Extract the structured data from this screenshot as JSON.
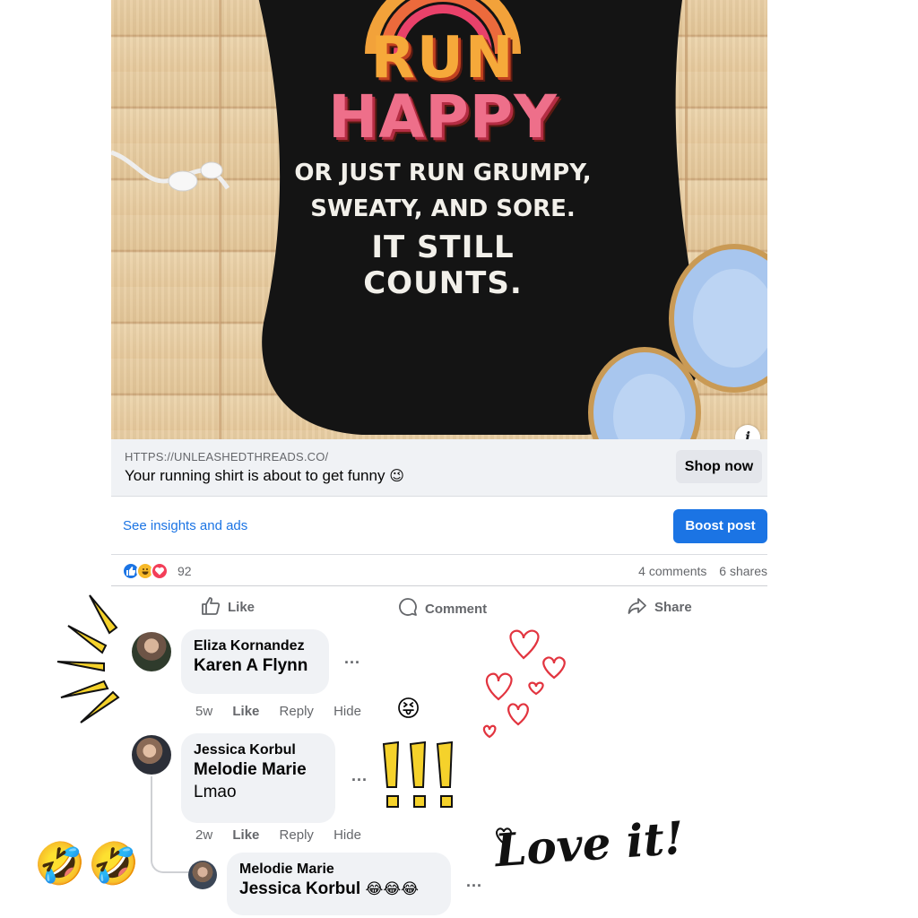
{
  "ad": {
    "print": {
      "line1": "RUN",
      "line2": "HAPPY",
      "line3": "OR JUST RUN GRUMPY,",
      "line4": "SWEATY, AND SORE.",
      "line5": "IT STILL COUNTS."
    },
    "info_icon": "info-icon",
    "link_url": "HTTPS://UNLEASHEDTHREADS.CO/",
    "link_title": "Your running shirt is about to get funny",
    "link_title_emoji": "😉",
    "shop_button": "Shop now"
  },
  "insights": {
    "link": "See insights and ads",
    "boost_button": "Boost post"
  },
  "reactions": {
    "icons": [
      "like-icon",
      "haha-icon",
      "love-icon"
    ],
    "count": "92",
    "comments": "4 comments",
    "shares": "6 shares"
  },
  "actions": {
    "like": "Like",
    "comment": "Comment",
    "share": "Share"
  },
  "comments": [
    {
      "author": "Eliza Kornandez",
      "tag": "Karen A Flynn",
      "text": "",
      "time": "5w",
      "like": "Like",
      "reply": "Reply",
      "hide": "Hide",
      "reaction_emoji": "😝"
    },
    {
      "author": "Jessica Korbul",
      "tag": "Melodie Marie",
      "text": "Lmao",
      "time": "2w",
      "like": "Like",
      "reply": "Reply",
      "hide": "Hide"
    },
    {
      "author": "Melodie Marie",
      "tag": "Jessica Korbul",
      "emojis": "😂😂😂"
    }
  ],
  "more_options": "...",
  "decorations": {
    "love_text": "Love it!",
    "laugh_emoji": "🤣",
    "exclamation": "!!!"
  },
  "colors": {
    "accent_blue": "#1b74e4",
    "bubble_gray": "#f0f2f5",
    "secondary_text": "#65676b",
    "shirt_black": "#141414"
  }
}
